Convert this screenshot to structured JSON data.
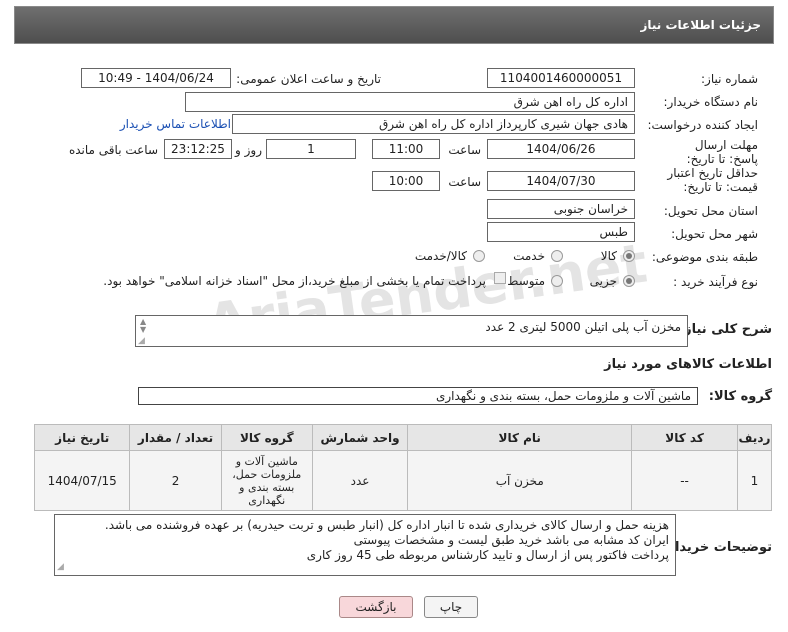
{
  "header": {
    "title": "جزئیات اطلاعات نیاز"
  },
  "fields": {
    "need_number_label": "شماره نیاز:",
    "need_number": "1104001460000051",
    "announce_label": "تاریخ و ساعت اعلان عمومی:",
    "announce_value": "1404/06/24 - 10:49",
    "buyer_org_label": "نام دستگاه خریدار:",
    "buyer_org": "اداره کل راه اهن شرق",
    "creator_label": "ایجاد کننده درخواست:",
    "creator": "هادی جهان شیری کارپرداز اداره کل راه اهن شرق",
    "contact_link": "اطلاعات تماس خریدار",
    "deadline_label": "مهلت ارسال پاسخ: تا تاریخ:",
    "deadline_date": "1404/06/26",
    "time_label": "ساعت",
    "deadline_time": "11:00",
    "days_value": "1",
    "days_label": "روز و",
    "remaining_time": "23:12:25",
    "remaining_label": "ساعت باقی مانده",
    "validity_label": "حداقل تاریخ اعتبار قیمت: تا تاریخ:",
    "validity_date": "1404/07/30",
    "validity_time_label": "ساعت",
    "validity_time": "10:00",
    "province_label": "استان محل تحویل:",
    "province": "خراسان جنوبی",
    "city_label": "شهر محل تحویل:",
    "city": "طبس",
    "category_label": "طبقه بندی موضوعی:",
    "category_options": [
      "کالا",
      "خدمت",
      "کالا/خدمت"
    ],
    "category_selected": 0,
    "process_label": "نوع فرآیند خرید :",
    "process_options": [
      "جزیی",
      "متوسط"
    ],
    "process_selected": 0,
    "payment_note": "پرداخت تمام یا بخشی از مبلغ خرید،از محل \"اسناد خزانه اسلامی\" خواهد بود."
  },
  "description": {
    "label": "شرح کلی نیاز:",
    "text": "مخزن آب پلی اتیلن 5000 لیتری    2 عدد"
  },
  "goods_info": {
    "title": "اطلاعات کالاهای مورد نیاز",
    "group_label": "گروه کالا:",
    "group_value": "ماشین آلات و ملزومات حمل، بسته بندی و نگهداری"
  },
  "table": {
    "headers": [
      "ردیف",
      "کد کالا",
      "نام کالا",
      "واحد شمارش",
      "گروه کالا",
      "تعداد / مقدار",
      "تاریخ نیاز"
    ],
    "rows": [
      [
        "1",
        "--",
        "مخزن آب",
        "عدد",
        "ماشین آلات و ملزومات حمل، بسته بندی و نگهداری",
        "2",
        "1404/07/15"
      ]
    ]
  },
  "buyer_notes": {
    "label": "توضیحات خریدار:",
    "lines": [
      "هزینه حمل و ارسال کالای خریداری شده تا انبار اداره کل (انبار طبس و تربت حیدریه) بر عهده فروشنده می باشد.",
      "ایران کد مشابه می باشد خرید طبق لیست و مشخصات پیوستی",
      "پرداخت فاکتور پس از ارسال و تایید کارشناس مربوطه طی 45 روز کاری"
    ]
  },
  "buttons": {
    "print": "چاپ",
    "back": "بازگشت"
  },
  "watermark": "AriaTender.net",
  "colors": {
    "header_bg": "#5a5a5a",
    "link": "#1a4fb3",
    "back_button_bg": "#f8d7da"
  }
}
